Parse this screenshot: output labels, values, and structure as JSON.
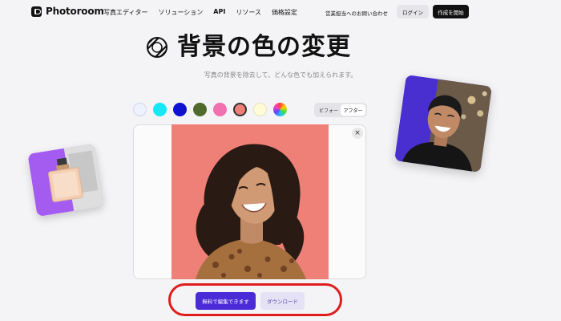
{
  "brand": {
    "name": "Photoroom"
  },
  "nav": {
    "links": [
      "写真エディター",
      "ソリューション",
      "API",
      "リソース",
      "価格設定"
    ],
    "sales_contact": "営業担当へのお問い合わせ",
    "login": "ログイン",
    "start": "作成を開始"
  },
  "hero": {
    "title": "背景の色の変更",
    "subtitle": "写真の背景を除去して、どんな色でも加えられます。",
    "icon": "striped-circle-icon"
  },
  "swatches": [
    "#eef2ff",
    "#14e9f5",
    "#1010d0",
    "#4f6a2c",
    "#f070b0",
    "#ef8078",
    "#fffbd6",
    "rainbow"
  ],
  "toggle": {
    "before": "ビフォー",
    "after": "アフター",
    "selected": "アフター"
  },
  "editor": {
    "close": "×",
    "background_color": "#ef8078"
  },
  "actions": {
    "edit_free": "無料で編集できます",
    "download": "ダウンロード"
  },
  "colors": {
    "accent": "#4b2ad8",
    "highlight": "#e01d1d",
    "dark": "#111111"
  }
}
